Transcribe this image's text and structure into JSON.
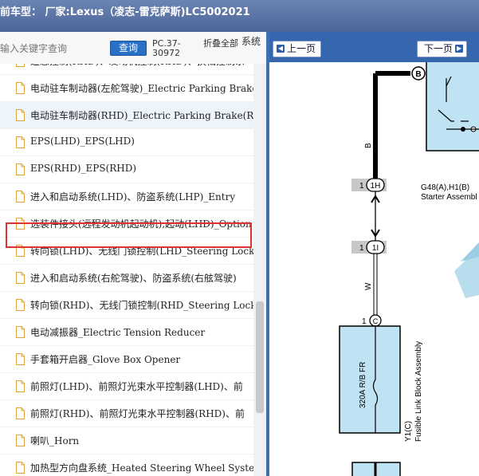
{
  "window": {
    "title": "前车型：  厂家:Lexus（凌志-雷克萨斯)LC5002021"
  },
  "search": {
    "placeholder": "输入关键字查询",
    "button_label": "查询",
    "pc_code": "PC.37-30972",
    "collapse_label": "折叠全部",
    "clipped_label": "系统"
  },
  "tree": {
    "items": [
      {
        "label": "遥感控制(RHD)、发动机控制(RHD)、换档控制系"
      },
      {
        "label": "电动驻车制动器(左舵驾驶)_Electric Parking Brake"
      },
      {
        "label": "电动驻车制动器(RHD)_Electric Parking Brake(RHD"
      },
      {
        "label": "EPS(LHD)_EPS(LHD)"
      },
      {
        "label": "EPS(RHD)_EPS(RHD)"
      },
      {
        "label": "进入和启动系统(LHD)、防盗系统(LHP)_Entry"
      },
      {
        "label": "选装件接头(远程发动机起动机),起动(LHD)_Option"
      },
      {
        "label": "转向锁(LHD)、无线门锁控制(LHD_Steering Lock("
      },
      {
        "label": "进入和启动系统(右舵驾驶)、防盗系统(右舷驾驶)"
      },
      {
        "label": "转向锁(RHD)、无线门锁控制(RHD_Steering Lock"
      },
      {
        "label": "电动减振器_Electric Tension Reducer"
      },
      {
        "label": "手套箱开启器_Glove Box Opener"
      },
      {
        "label": "前照灯(LHD)、前照灯光束水平控制器(LHD)、前"
      },
      {
        "label": "前照灯(RHD)、前照灯光束水平控制器(RHD)、前"
      },
      {
        "label": "喇叭_Horn"
      },
      {
        "label": "加热型方向盘系统_Heated Steering Wheel System"
      }
    ],
    "selected_index": 2,
    "highlighted_index": 5
  },
  "viewer": {
    "prev_label": "上一页",
    "next_label": "下一页",
    "labels": {
      "conn_b": "B",
      "wire_b": "B",
      "conn_1h_pin": "1",
      "conn_1h": "1H",
      "starter_ref": "G48(A),H1(B)",
      "starter_name": "Starter Assembl",
      "conn_1i_pin": "1",
      "conn_1i": "1I",
      "wire_w": "W",
      "conn_c_pin": "1",
      "conn_c": "C",
      "fuse": "320A R/B FR",
      "block_ref": "Y1(C)",
      "block_name": "Fusible Link Block Assembly"
    },
    "colors": {
      "wire_b": "#000000",
      "box_fill": "#bfe3f2",
      "connector_fill": "#c8c8c8"
    }
  }
}
